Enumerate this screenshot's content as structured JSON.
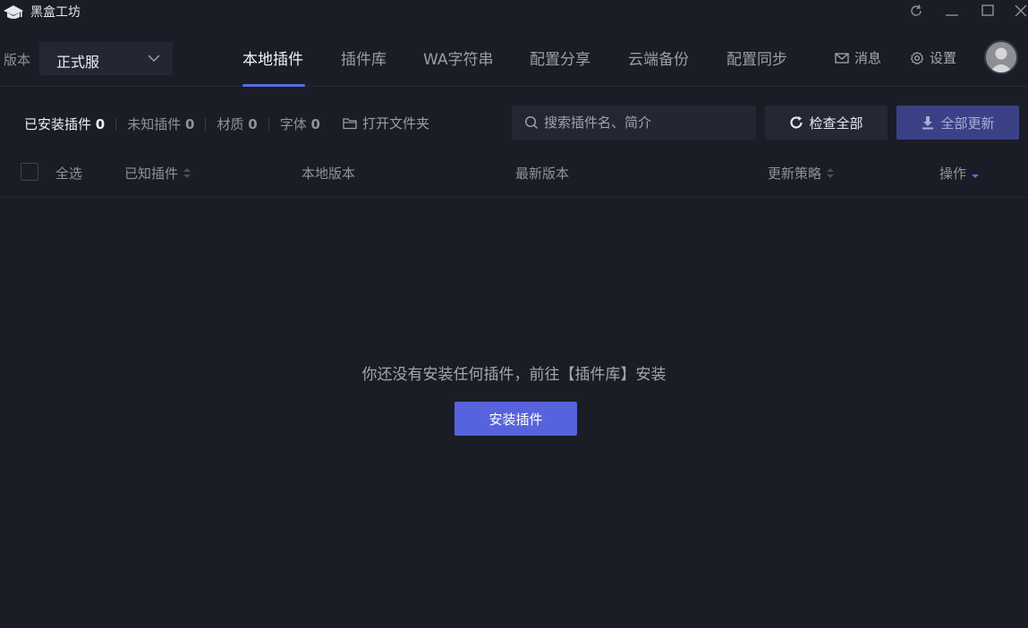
{
  "titlebar": {
    "app_title": "黑盒工坊",
    "controls": [
      "refresh-icon",
      "minimize-icon",
      "maximize-icon",
      "close-icon"
    ]
  },
  "nav": {
    "version_label": "版本",
    "version_value": "正式服",
    "tabs": [
      {
        "label": "本地插件",
        "active": true
      },
      {
        "label": "插件库",
        "active": false
      },
      {
        "label": "WA字符串",
        "active": false
      },
      {
        "label": "配置分享",
        "active": false
      },
      {
        "label": "云端备份",
        "active": false
      },
      {
        "label": "配置同步",
        "active": false
      }
    ],
    "messages_label": "消息",
    "settings_label": "设置",
    "accent_color": "#5a6ae2"
  },
  "toolbar": {
    "filters": [
      {
        "label": "已安装插件",
        "count": "0",
        "active": true
      },
      {
        "label": "未知插件",
        "count": "0",
        "active": false
      },
      {
        "label": "材质",
        "count": "0",
        "active": false
      },
      {
        "label": "字体",
        "count": "0",
        "active": false
      }
    ],
    "open_folder_label": "打开文件夹",
    "search_placeholder": "搜索插件名、简介",
    "check_all_label": "检查全部",
    "update_all_label": "全部更新"
  },
  "table": {
    "select_all_label": "全选",
    "columns": [
      {
        "label": "已知插件",
        "sortable": true
      },
      {
        "label": "本地版本",
        "sortable": false
      },
      {
        "label": "最新版本",
        "sortable": false
      },
      {
        "label": "更新策略",
        "sortable": true
      },
      {
        "label": "操作",
        "sortable": true,
        "sort": "desc"
      }
    ]
  },
  "empty_state": {
    "message": "你还没有安装任何插件，前往【插件库】安装",
    "button_label": "安装插件",
    "button_color": "#5763dc"
  }
}
